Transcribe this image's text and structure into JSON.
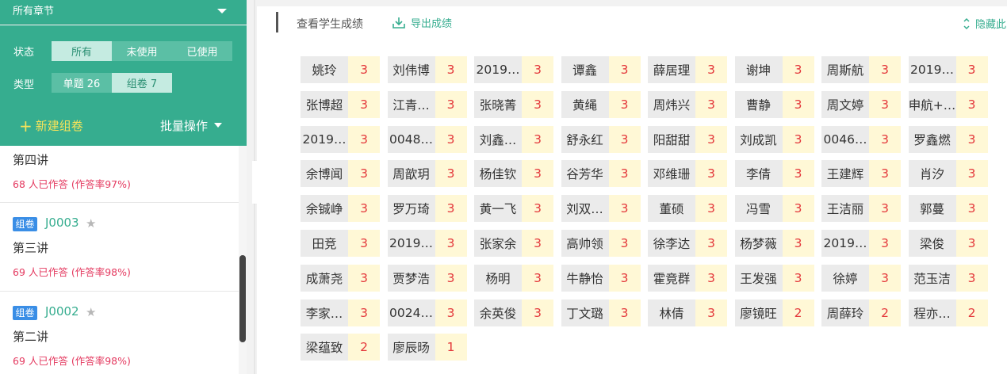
{
  "sidebar": {
    "chapter_select": "所有章节",
    "status_label": "状态",
    "status_options": [
      "所有",
      "未使用",
      "已使用"
    ],
    "type_label": "类型",
    "type_options": [
      "单题 26",
      "组卷 7"
    ],
    "new_set": "新建组卷",
    "batch": "批量操作",
    "cards": [
      {
        "title": "第四讲",
        "rate": "68 人已作答 (作答率97%)"
      },
      {
        "tag": "组卷",
        "code": "J0003",
        "title": "第三讲",
        "rate": "69 人已作答 (作答率98%)"
      },
      {
        "tag": "组卷",
        "code": "J0002",
        "title": "第二讲",
        "rate": "69 人已作答 (作答率98%)"
      }
    ]
  },
  "toolbar": {
    "view_scores": "查看学生成绩",
    "export": "导出成绩",
    "hide": "隐藏此"
  },
  "students": [
    [
      "姚玲",
      "3"
    ],
    [
      "刘伟博",
      "3"
    ],
    [
      "2019…",
      "3"
    ],
    [
      "谭鑫",
      "3"
    ],
    [
      "薛居理",
      "3"
    ],
    [
      "谢坤",
      "3"
    ],
    [
      "周斯航",
      "3"
    ],
    [
      "2019…",
      "3"
    ],
    [
      "张博超",
      "3"
    ],
    [
      "江青…",
      "3"
    ],
    [
      "张晓菁",
      "3"
    ],
    [
      "黄绳",
      "3"
    ],
    [
      "周炜兴",
      "3"
    ],
    [
      "曹静",
      "3"
    ],
    [
      "周文婷",
      "3"
    ],
    [
      "申航+…",
      "3"
    ],
    [
      "2019…",
      "3"
    ],
    [
      "0048…",
      "3"
    ],
    [
      "刘鑫…",
      "3"
    ],
    [
      "舒永红",
      "3"
    ],
    [
      "阳甜甜",
      "3"
    ],
    [
      "刘成凯",
      "3"
    ],
    [
      "0046…",
      "3"
    ],
    [
      "罗鑫燃",
      "3"
    ],
    [
      "余博闻",
      "3"
    ],
    [
      "周歆玥",
      "3"
    ],
    [
      "杨佳钦",
      "3"
    ],
    [
      "谷芳华",
      "3"
    ],
    [
      "邓维珊",
      "3"
    ],
    [
      "李倩",
      "3"
    ],
    [
      "王建辉",
      "3"
    ],
    [
      "肖汐",
      "3"
    ],
    [
      "余铖峥",
      "3"
    ],
    [
      "罗万琦",
      "3"
    ],
    [
      "黄一飞",
      "3"
    ],
    [
      "刘双…",
      "3"
    ],
    [
      "董硕",
      "3"
    ],
    [
      "冯雪",
      "3"
    ],
    [
      "王洁丽",
      "3"
    ],
    [
      "郭蔓",
      "3"
    ],
    [
      "田竞",
      "3"
    ],
    [
      "2019…",
      "3"
    ],
    [
      "张家余",
      "3"
    ],
    [
      "高帅领",
      "3"
    ],
    [
      "徐李达",
      "3"
    ],
    [
      "杨梦薇",
      "3"
    ],
    [
      "2019…",
      "3"
    ],
    [
      "梁俊",
      "3"
    ],
    [
      "成萧尧",
      "3"
    ],
    [
      "贾梦浩",
      "3"
    ],
    [
      "杨明",
      "3"
    ],
    [
      "牛静怡",
      "3"
    ],
    [
      "霍竟群",
      "3"
    ],
    [
      "王发强",
      "3"
    ],
    [
      "徐婷",
      "3"
    ],
    [
      "范玉洁",
      "3"
    ],
    [
      "李家…",
      "3"
    ],
    [
      "0024…",
      "3"
    ],
    [
      "余英俊",
      "3"
    ],
    [
      "丁文璐",
      "3"
    ],
    [
      "林倩",
      "3"
    ],
    [
      "廖镜旺",
      "2"
    ],
    [
      "周薛玲",
      "2"
    ],
    [
      "程亦…",
      "2"
    ],
    [
      "梁蕴致",
      "2"
    ],
    [
      "廖辰旸",
      "1"
    ]
  ]
}
